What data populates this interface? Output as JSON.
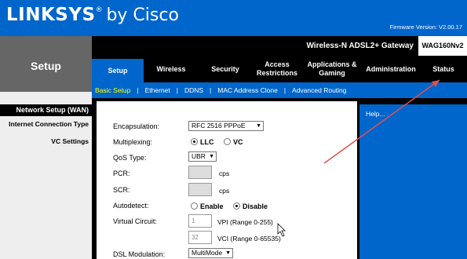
{
  "brand": {
    "name": "LINKSYS",
    "registered": "®",
    "suffix": "by Cisco"
  },
  "firmware": {
    "label": "Firmware Version:",
    "value": "V2.00.17"
  },
  "product": {
    "name": "Wireless-N ADSL2+ Gateway",
    "model": "WAG160Nv2"
  },
  "section_title": "Setup",
  "tabs": [
    {
      "label": "Setup"
    },
    {
      "label": "Wireless"
    },
    {
      "label": "Security"
    },
    {
      "label": "Access Restrictions"
    },
    {
      "label": "Applications & Gaming"
    },
    {
      "label": "Administration"
    },
    {
      "label": "Status"
    }
  ],
  "subtabs": [
    {
      "label": "Basic Setup"
    },
    {
      "label": "Ethernet"
    },
    {
      "label": "DDNS"
    },
    {
      "label": "MAC Address Clone"
    },
    {
      "label": "Advanced Routing"
    }
  ],
  "sidebar": {
    "heading": "Network Setup (WAN)",
    "items": [
      "Internet Connection Type",
      "VC Settings"
    ]
  },
  "form": {
    "encapsulation": {
      "label": "Encapsulation:",
      "value": "RFC 2516 PPPoE"
    },
    "multiplexing": {
      "label": "Multiplexing:",
      "options": [
        "LLC",
        "VC"
      ],
      "selected": "LLC"
    },
    "qos": {
      "label": "QoS Type:",
      "value": "UBR"
    },
    "pcr": {
      "label": "PCR:",
      "value": "",
      "unit": "cps"
    },
    "scr": {
      "label": "SCR:",
      "value": "",
      "unit": "cps"
    },
    "autodetect": {
      "label": "Autodetect:",
      "options": [
        "Enable",
        "Disable"
      ],
      "selected": "Disable"
    },
    "virtual_circuit": {
      "label": "Virtual Circuit:",
      "vpi": {
        "value": "1",
        "unit": "VPI (Range 0-255)"
      },
      "vci": {
        "value": "32",
        "unit": "VCI (Range 0-65535)"
      }
    },
    "dsl_modulation": {
      "label": "DSL Modulation:",
      "value": "MultiMode"
    }
  },
  "help": {
    "text": "Help..."
  },
  "colors": {
    "brand_blue": "#0066cc",
    "header_black": "#000000",
    "sidebar_grey": "#666666",
    "annotation_red": "#e05050"
  }
}
